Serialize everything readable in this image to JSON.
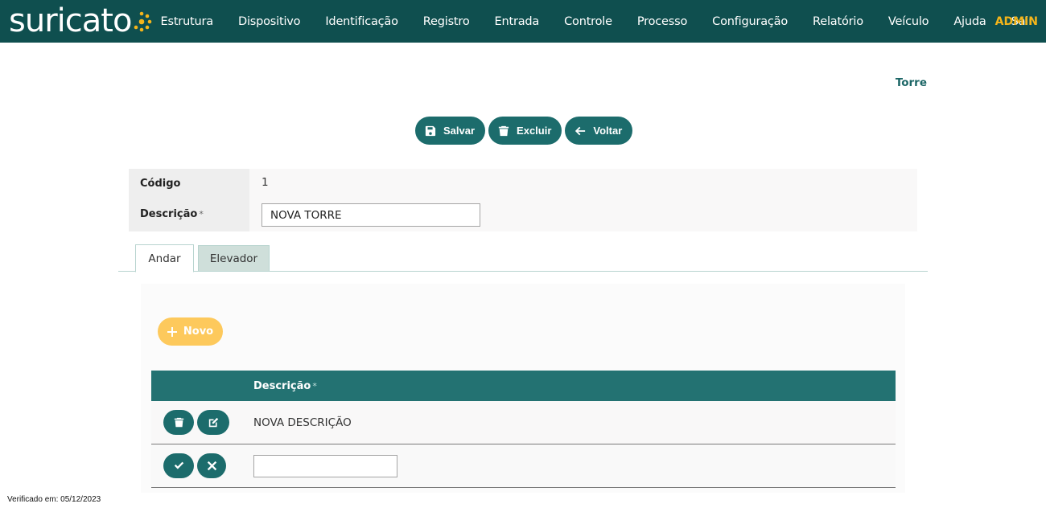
{
  "brand": {
    "logo_text": "suricato"
  },
  "nav": {
    "items": [
      {
        "label": "Estrutura"
      },
      {
        "label": "Dispositivo"
      },
      {
        "label": "Identificação"
      },
      {
        "label": "Registro"
      },
      {
        "label": "Entrada"
      },
      {
        "label": "Controle"
      },
      {
        "label": "Processo"
      },
      {
        "label": "Configuração"
      },
      {
        "label": "Relatório"
      },
      {
        "label": "Veículo"
      },
      {
        "label": "Ajuda"
      },
      {
        "label": "Sair"
      }
    ],
    "user": "ADMIN"
  },
  "page": {
    "heading": "Torre"
  },
  "actions": {
    "save_label": "Salvar",
    "delete_label": "Excluir",
    "back_label": "Voltar"
  },
  "form": {
    "code_label": "Código",
    "code_value": "1",
    "description_label": "Descrição",
    "required_mark": "*",
    "description_value": "NOVA TORRE"
  },
  "tabs": [
    {
      "label": "Andar",
      "active": true
    },
    {
      "label": "Elevador",
      "active": false
    }
  ],
  "andar": {
    "new_label": "Novo",
    "table": {
      "header_description": "Descrição",
      "required_mark": "*",
      "rows": [
        {
          "description": "NOVA DESCRIÇÃO"
        }
      ],
      "new_row_value": ""
    }
  },
  "footer": {
    "verified": "Verificado em: 05/12/2023"
  },
  "colors": {
    "navbar": "#0f4f4f",
    "primary": "#1c6c6c",
    "accent": "#f5b51a",
    "new_button": "#fdc95c",
    "table_header": "#237272"
  },
  "icons": {
    "save": "floppy-disk-icon",
    "delete": "trash-icon",
    "back": "arrow-left-icon",
    "new": "plus-icon",
    "edit": "pencil-square-icon",
    "confirm": "check-icon",
    "cancel": "x-icon"
  }
}
